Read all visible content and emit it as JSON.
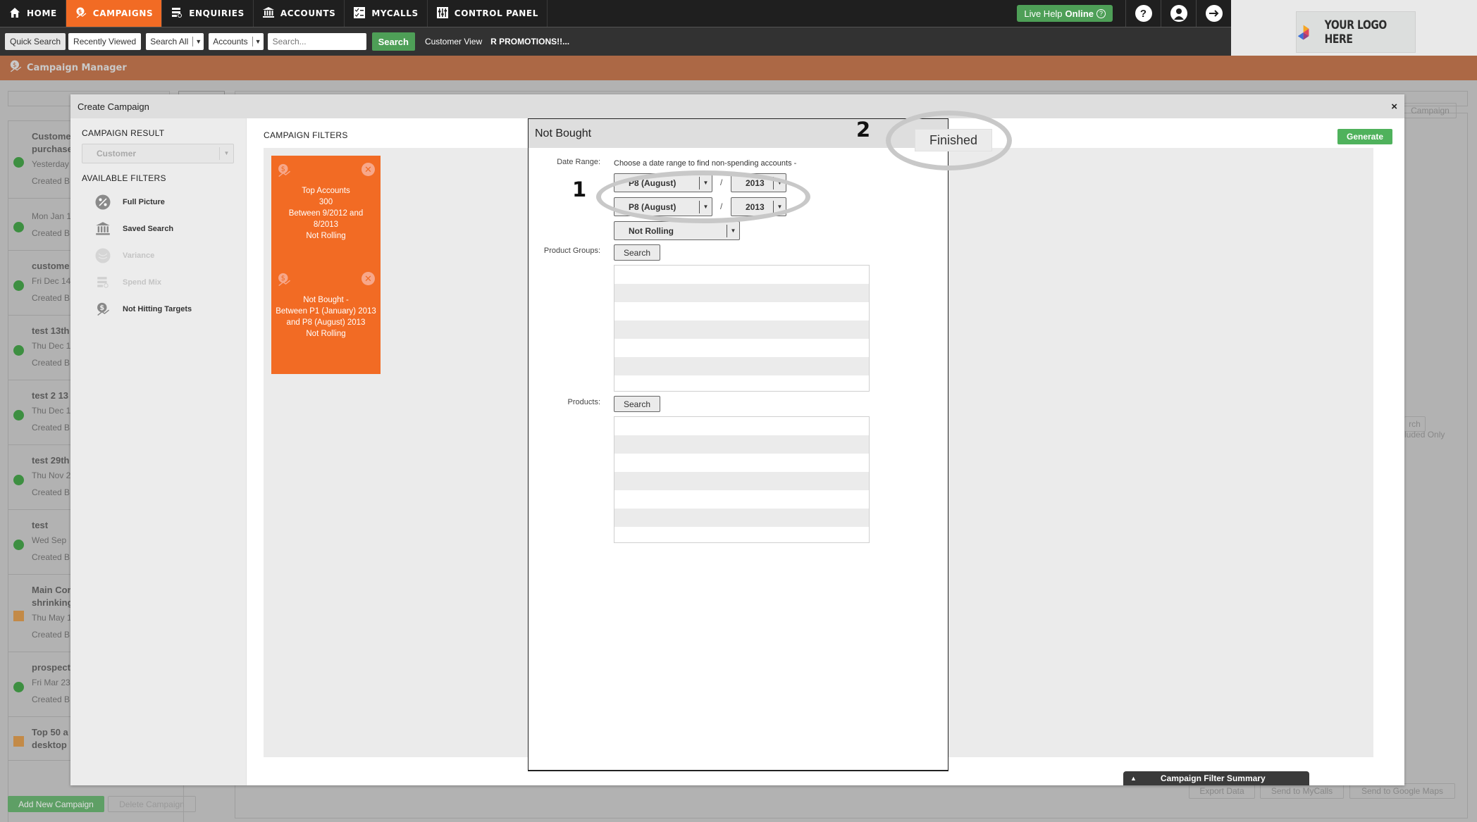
{
  "nav": {
    "items": [
      {
        "label": "HOME",
        "icon": "home-icon",
        "active": false
      },
      {
        "label": "CAMPAIGNS",
        "icon": "campaign-icon",
        "active": true
      },
      {
        "label": "ENQUIRIES",
        "icon": "enquiries-icon",
        "active": false
      },
      {
        "label": "ACCOUNTS",
        "icon": "bank-icon",
        "active": false
      },
      {
        "label": "MYCALLS",
        "icon": "checklist-icon",
        "active": false
      },
      {
        "label": "CONTROL PANEL",
        "icon": "control-panel-icon",
        "active": false
      }
    ],
    "live_help": {
      "prefix": "Live Help",
      "status": "Online",
      "q": "?"
    },
    "help_icon": "?",
    "logo_text": "YOUR LOGO HERE"
  },
  "searchbar": {
    "quick_search": "Quick Search",
    "recently_viewed": "Recently Viewed",
    "scope_select": "Search All",
    "type_select": "Accounts",
    "input_placeholder": "Search...",
    "input_value": "",
    "search_button": "Search",
    "customer_view": "Customer View",
    "promo_text": "R PROMOTIONS!!..."
  },
  "page": {
    "title": "Campaign Manager"
  },
  "background": {
    "campaigns": [
      {
        "name_lines": [
          "Custome",
          "purchase"
        ],
        "meta": [
          "Yesterday",
          "Created B"
        ],
        "status": "green"
      },
      {
        "name_lines": [],
        "meta": [
          "Mon Jan 1",
          "Created B"
        ],
        "status": "green"
      },
      {
        "name_lines": [
          "custome"
        ],
        "meta": [
          "Fri Dec 14",
          "Created B"
        ],
        "status": "green"
      },
      {
        "name_lines": [
          "test 13th"
        ],
        "meta": [
          "Thu Dec 1",
          "Created B"
        ],
        "status": "green"
      },
      {
        "name_lines": [
          "test 2 13"
        ],
        "meta": [
          "Thu Dec 1",
          "Created B"
        ],
        "status": "green"
      },
      {
        "name_lines": [
          "test 29th"
        ],
        "meta": [
          "Thu Nov 2",
          "Created B"
        ],
        "status": "green"
      },
      {
        "name_lines": [
          "test"
        ],
        "meta": [
          "Wed Sep",
          "Created B"
        ],
        "status": "green"
      },
      {
        "name_lines": [
          "Main Cor",
          "shrinking"
        ],
        "meta": [
          "Thu May 1",
          "Created B"
        ],
        "status": "orange"
      },
      {
        "name_lines": [
          "prospect"
        ],
        "meta": [
          "Fri Mar 23",
          "Created B"
        ],
        "status": "green"
      },
      {
        "name_lines": [
          "Top 50 a",
          "desktop"
        ],
        "meta": [],
        "status": "orange"
      }
    ],
    "add_campaign": "Add New Campaign",
    "delete_campaign": "Delete Campaign",
    "right_campaign_btn": "Campaign",
    "included_only": "luded Only",
    "right_search_btn": "rch",
    "export_data": "Export Data",
    "send_mycalls": "Send to MyCalls",
    "send_maps": "Send to Google Maps"
  },
  "modal": {
    "title": "Create Campaign",
    "close": "×",
    "campaign_result_title": "CAMPAIGN RESULT",
    "campaign_result_value": "Customer",
    "available_filters_title": "AVAILABLE FILTERS",
    "available_filters": [
      {
        "label": "Full Picture",
        "icon": "percent-icon",
        "enabled": true
      },
      {
        "label": "Saved Search",
        "icon": "bank-icon",
        "enabled": true
      },
      {
        "label": "Variance",
        "icon": "variance-icon",
        "enabled": false
      },
      {
        "label": "Spend Mix",
        "icon": "spend-mix-icon",
        "enabled": false
      },
      {
        "label": "Not Hitting Targets",
        "icon": "campaign-icon",
        "enabled": true
      }
    ],
    "campaign_filters_title": "CAMPAIGN FILTERS",
    "filter_cards": [
      {
        "lines": [
          "Top Accounts",
          "300",
          "Between 9/2012 and",
          "8/2013",
          "Not Rolling"
        ]
      },
      {
        "lines": [
          "Not Bought -",
          "Between P1 (January) 2013",
          "and P8 (August) 2013",
          "Not Rolling"
        ]
      }
    ],
    "generate": "Generate",
    "summary_tab": "Campaign Filter Summary"
  },
  "not_bought": {
    "title": "Not Bought",
    "finished": "Finished",
    "date_range_label": "Date Range:",
    "date_range_hint": "Choose a date range to find non-spending accounts -",
    "from_period": "P8 (August)",
    "from_year": "2013",
    "to_period": "P8 (August)",
    "to_year": "2013",
    "separator": "/",
    "rolling": "Not Rolling",
    "product_groups_label": "Product Groups:",
    "products_label": "Products:",
    "search_btn": "Search",
    "product_groups": [],
    "products": []
  },
  "annotations": {
    "one": "1",
    "two": "2"
  }
}
